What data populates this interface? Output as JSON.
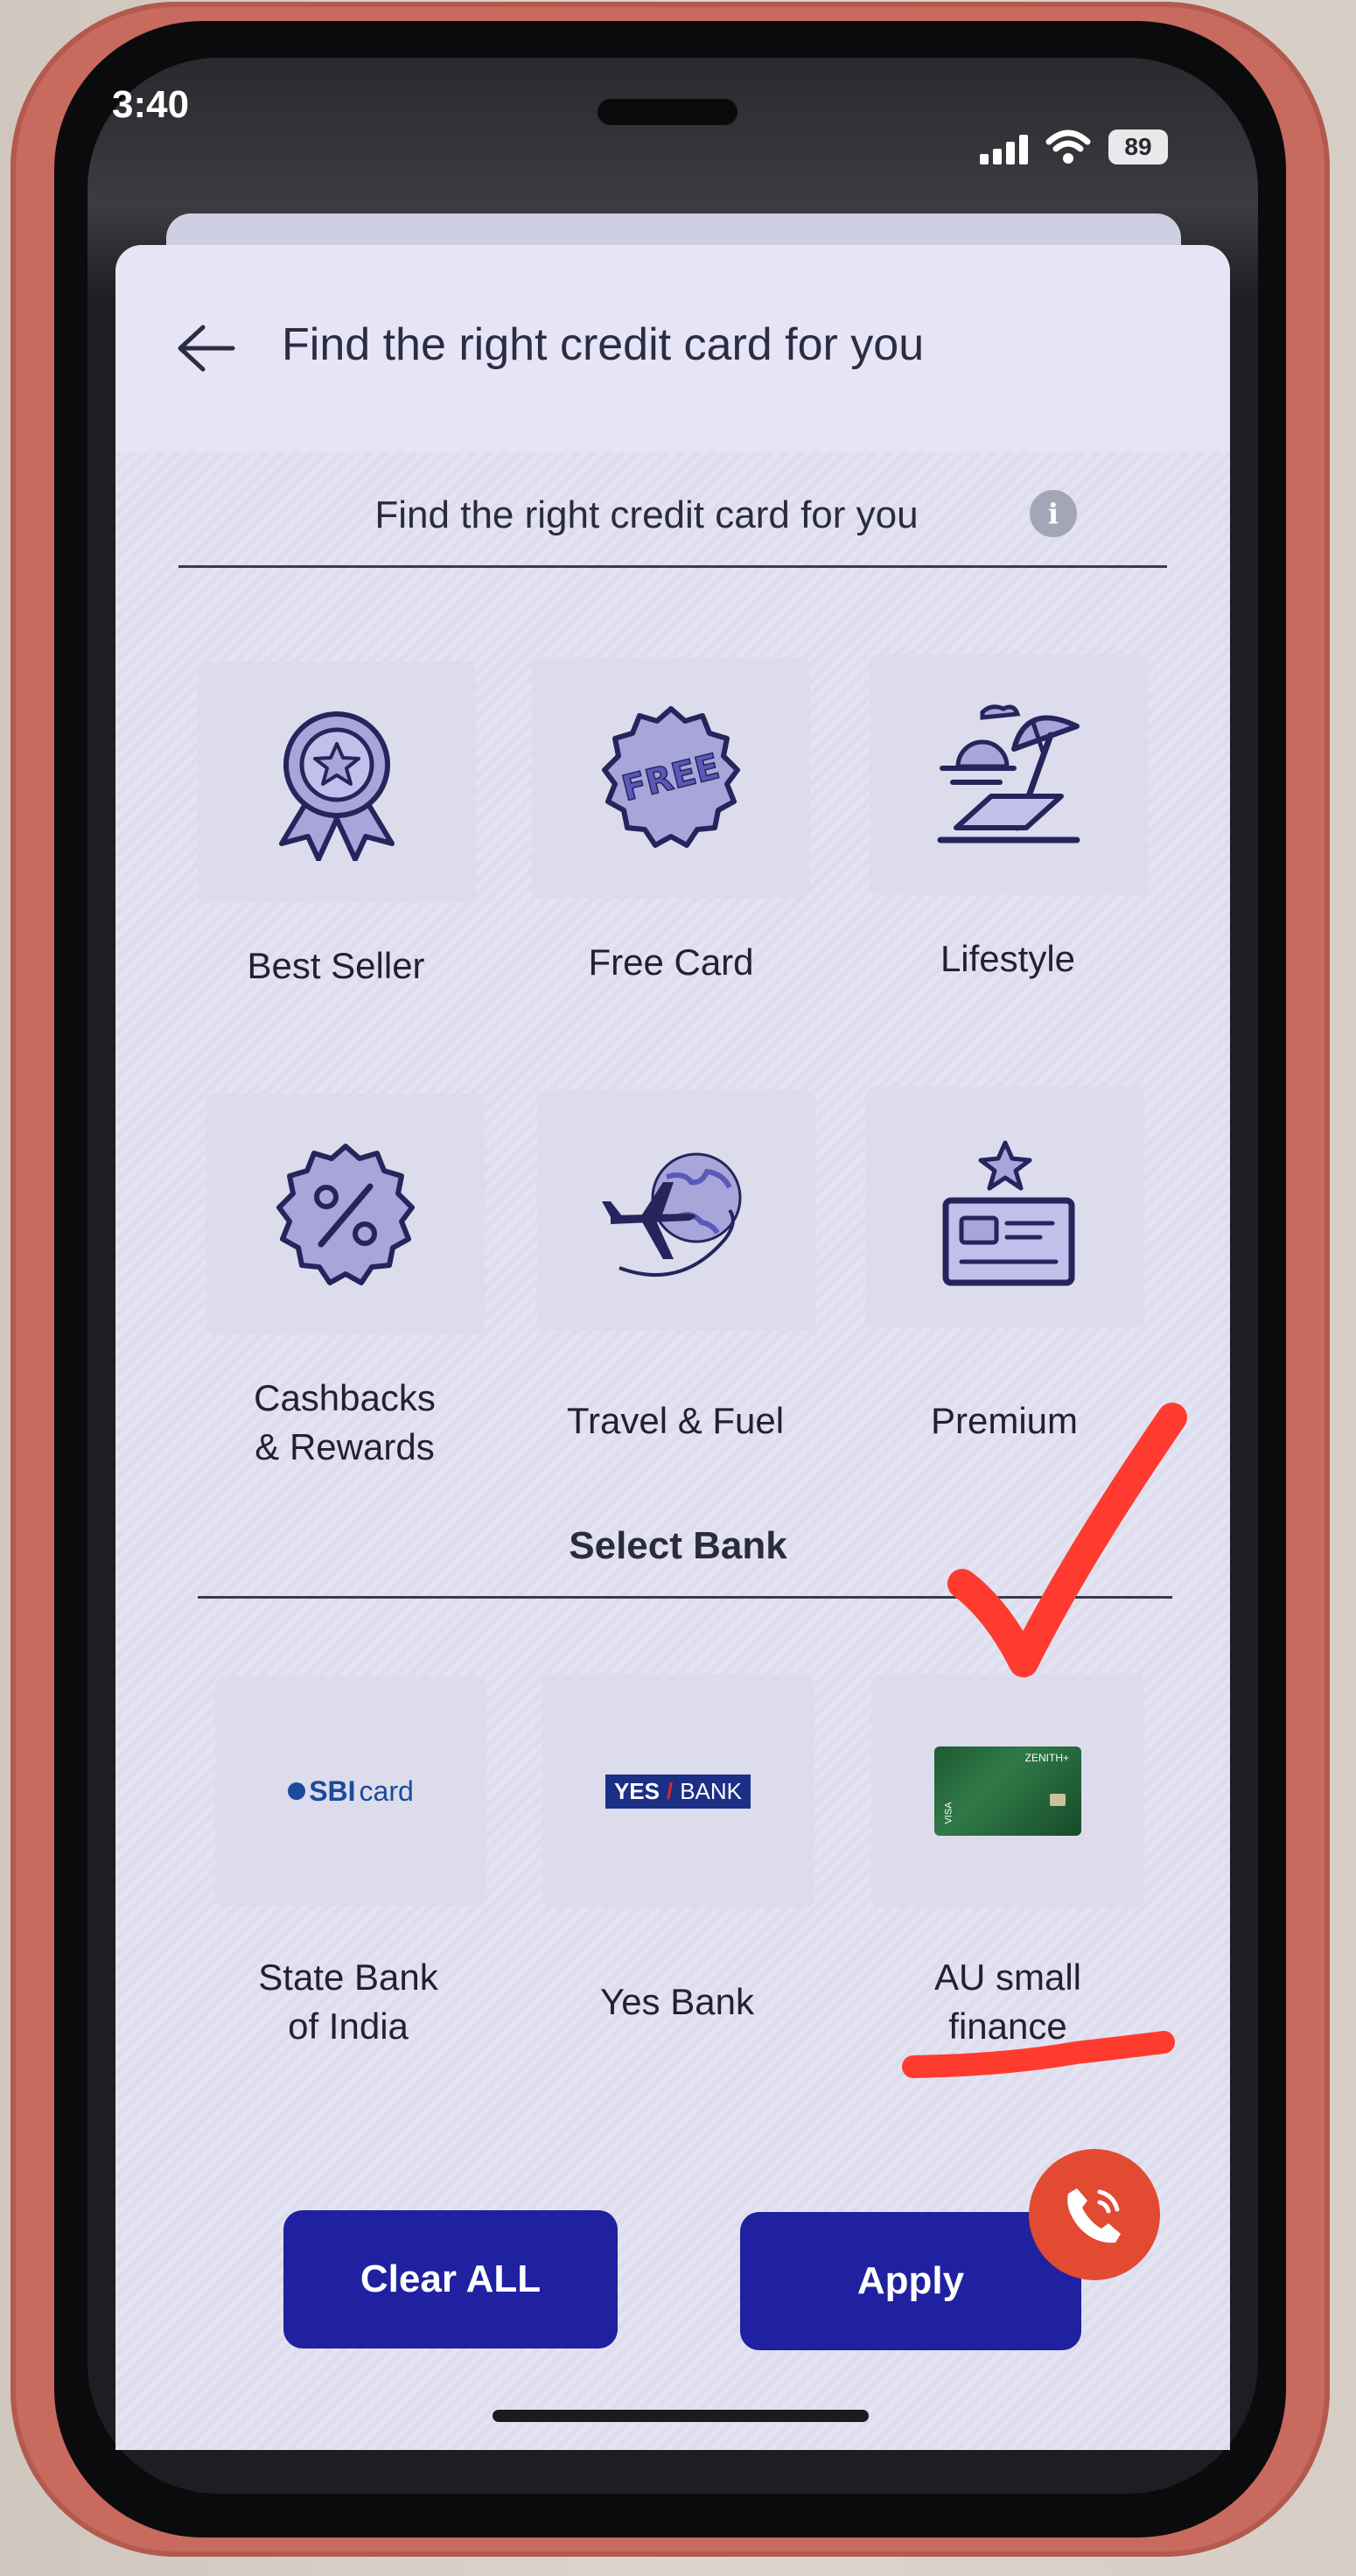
{
  "status_bar": {
    "time": "3:40",
    "battery": "89"
  },
  "header": {
    "title": "Find the right credit card for you"
  },
  "category_section": {
    "title": "Find the right credit card for you",
    "categories": [
      {
        "label": "Best Seller",
        "icon": "award-ribbon-icon"
      },
      {
        "label": "Free Card",
        "icon": "free-badge-icon",
        "badge_text": "FREE"
      },
      {
        "label": "Lifestyle",
        "icon": "beach-umbrella-icon"
      },
      {
        "label": "Cashbacks\n& Rewards",
        "icon": "percent-badge-icon"
      },
      {
        "label": "Travel & Fuel",
        "icon": "plane-globe-icon"
      },
      {
        "label": "Premium",
        "icon": "star-card-icon"
      }
    ]
  },
  "bank_section": {
    "title": "Select Bank",
    "banks": [
      {
        "label": "State Bank\nof India",
        "logo_text": "SBI",
        "logo_text2": "card"
      },
      {
        "label": "Yes Bank",
        "logo_text": "YES",
        "logo_text2": "BANK"
      },
      {
        "label": "AU small\nfinance",
        "card_brand": "ZENITH+",
        "card_network": "VISA"
      }
    ]
  },
  "actions": {
    "clear_label": "Clear ALL",
    "apply_label": "Apply"
  },
  "colors": {
    "primary_button": "#1f21a0",
    "call_button": "#e24a31",
    "annotation_red": "#ff3b30"
  }
}
